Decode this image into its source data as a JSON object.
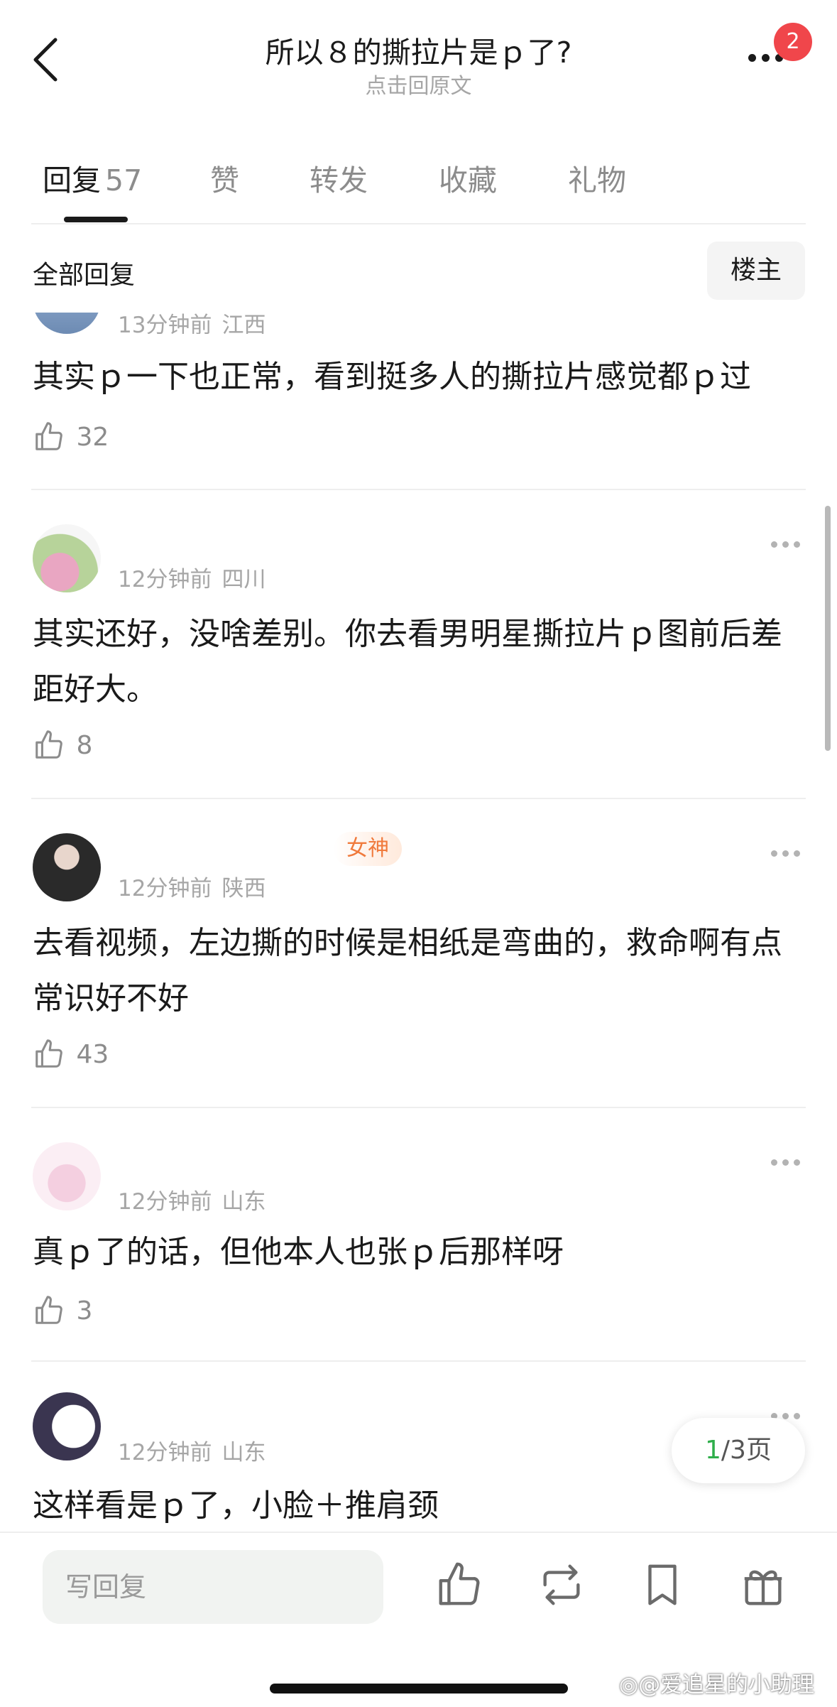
{
  "header": {
    "title": "所以８的撕拉片是ｐ了?",
    "subtitle": "点击回原文",
    "notification_count": "2"
  },
  "tabs": [
    {
      "label": "回复",
      "count": "57",
      "active": true
    },
    {
      "label": "赞"
    },
    {
      "label": "转发"
    },
    {
      "label": "收藏"
    },
    {
      "label": "礼物"
    }
  ],
  "filter": {
    "label": "全部回复",
    "op_button": "楼主"
  },
  "comments": [
    {
      "time": "13分钟前",
      "location": "江西",
      "text": "其实ｐ一下也正常，看到挺多人的撕拉片感觉都ｐ过",
      "likes": "32"
    },
    {
      "time": "12分钟前",
      "location": "四川",
      "text": "其实还好，没啥差别。你去看男明星撕拉片ｐ图前后差距好大。",
      "likes": "8"
    },
    {
      "badge": "女神",
      "time": "12分钟前",
      "location": "陕西",
      "text": "去看视频，左边撕的时候是相纸是弯曲的，救命啊有点常识好不好",
      "likes": "43"
    },
    {
      "time": "12分钟前",
      "location": "山东",
      "text": "真ｐ了的话，但他本人也张ｐ后那样呀",
      "likes": "3"
    },
    {
      "time": "12分钟前",
      "location": "山东",
      "text": "这样看是ｐ了，小脸＋推肩颈"
    }
  ],
  "pagination": {
    "current": "1",
    "total": "/3页"
  },
  "bottom_bar": {
    "reply_placeholder": "写回复"
  },
  "watermark": "@爱追星的小助理",
  "icons": [
    "back-arrow-icon",
    "more-icon",
    "thumb-up-icon",
    "repost-icon",
    "bookmark-icon",
    "gift-icon",
    "weibo-icon"
  ],
  "colors": {
    "badge_red": "#f0464b",
    "page_current_green": "#2fae4b",
    "badge_orange": "#f07a3c"
  }
}
